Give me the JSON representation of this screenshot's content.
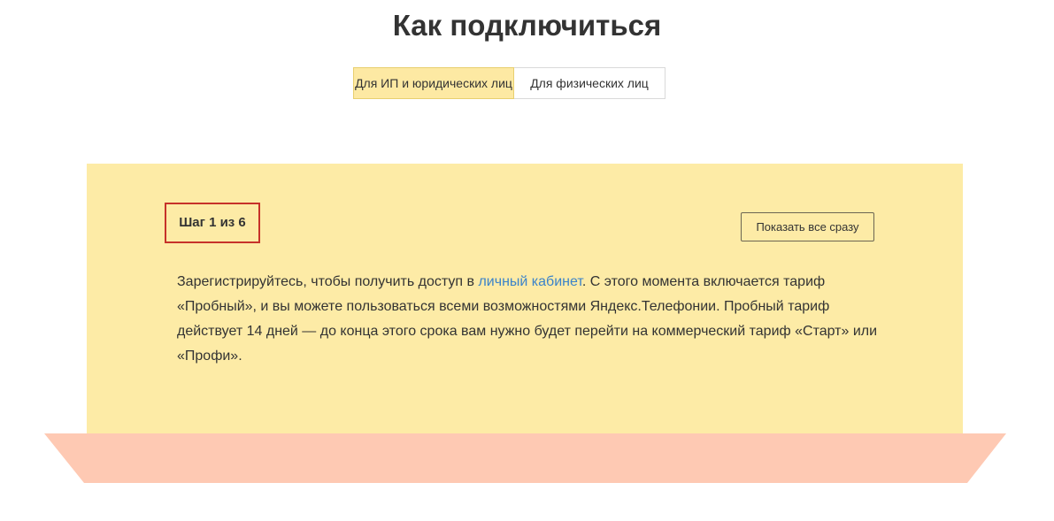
{
  "page": {
    "title": "Как подключиться"
  },
  "tabs": [
    {
      "label": "Для ИП и юридических лиц",
      "active": true
    },
    {
      "label": "Для физических лиц",
      "active": false
    }
  ],
  "step": {
    "label": "Шаг 1 из 6",
    "show_all_label": "Показать все сразу",
    "text_before_link": "Зарегистрируйтесь, чтобы получить доступ в ",
    "link_text": "личный кабинет",
    "text_after_link": ". С этого момента включается тариф «Пробный», и вы можете пользоваться всеми возможностями Яндекс.Телефонии. Пробный тариф действует 14 дней — до конца этого срока вам нужно будет перейти на коммерческий тариф «Старт» или «Профи»."
  },
  "colors": {
    "panel_bg": "#fdeba6",
    "active_tab_bg": "#fde9a3",
    "base_shape": "#fec9b3",
    "highlight_border": "#c6322a",
    "link": "#3b83c9"
  }
}
